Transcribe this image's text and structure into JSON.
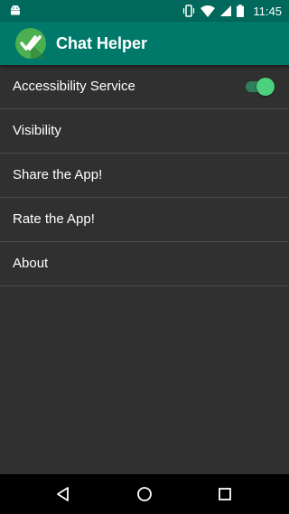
{
  "status_bar": {
    "time": "11:45",
    "icons": [
      "android-icon",
      "vibrate-icon",
      "wifi-icon",
      "signal-icon",
      "battery-icon"
    ]
  },
  "app_bar": {
    "title": "Chat Helper",
    "logo_icon": "double-check-icon",
    "logo_color": "#4caf50",
    "color": "#00796b"
  },
  "settings": {
    "items": [
      {
        "label": "Accessibility Service",
        "toggle": true
      },
      {
        "label": "Visibility"
      },
      {
        "label": "Share the App!"
      },
      {
        "label": "Rate the App!"
      },
      {
        "label": "About"
      }
    ]
  },
  "nav_bar": {
    "buttons": [
      "back-icon",
      "home-icon",
      "recents-icon"
    ]
  },
  "colors": {
    "status_bar": "#00695c",
    "background": "#303030",
    "toggle_on": "#4cd07d"
  }
}
